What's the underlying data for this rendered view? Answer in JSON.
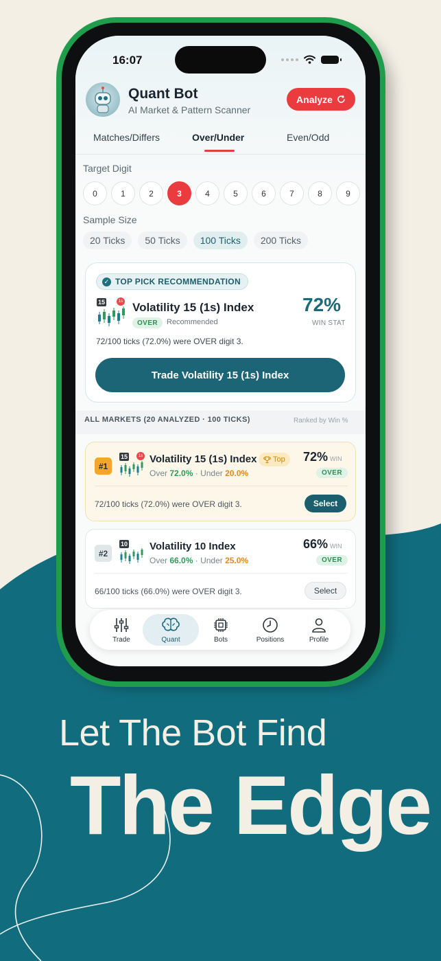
{
  "status": {
    "time": "16:07"
  },
  "app": {
    "title": "Quant Bot",
    "subtitle": "AI Market & Pattern Scanner",
    "analyze_label": "Analyze"
  },
  "tabs": [
    {
      "label": "Matches/Differs",
      "active": false
    },
    {
      "label": "Over/Under",
      "active": true
    },
    {
      "label": "Even/Odd",
      "active": false
    }
  ],
  "target_digit": {
    "label": "Target Digit",
    "options": [
      "0",
      "1",
      "2",
      "3",
      "4",
      "5",
      "6",
      "7",
      "8",
      "9"
    ],
    "selected": "3"
  },
  "sample_size": {
    "label": "Sample Size",
    "options": [
      "20 Ticks",
      "50 Ticks",
      "100 Ticks",
      "200 Ticks"
    ],
    "selected": "100 Ticks"
  },
  "top_pick": {
    "header": "TOP PICK RECOMMENDATION",
    "badge_number": "15",
    "badge_small": "1s",
    "name": "Volatility 15 (1s) Index",
    "direction": "OVER",
    "recommended": "Recommended",
    "percent": "72%",
    "win_stat": "WIN STAT",
    "detail": "72/100 ticks (72.0%) were OVER digit 3.",
    "trade_label": "Trade Volatility 15 (1s) Index"
  },
  "all_markets": {
    "label": "ALL MARKETS (20 ANALYZED · 100 TICKS)",
    "ranked_by": "Ranked by Win %",
    "items": [
      {
        "rank": "#1",
        "badge_number": "15",
        "badge_small": "1s",
        "name": "Volatility 15 (1s) Index",
        "top_tag": "Top",
        "over_label": "Over",
        "over_pct": "72.0%",
        "separator": "·",
        "under_label": "Under",
        "under_pct": "20.0%",
        "percent": "72%",
        "win": "WIN",
        "direction": "OVER",
        "detail": "72/100 ticks (72.0%) were OVER digit 3.",
        "select_label": "Select"
      },
      {
        "rank": "#2",
        "badge_number": "10",
        "name": "Volatility 10 Index",
        "over_label": "Over",
        "over_pct": "66.0%",
        "separator": "·",
        "under_label": "Under",
        "under_pct": "25.0%",
        "percent": "66%",
        "win": "WIN",
        "direction": "OVER",
        "detail": "66/100 ticks (66.0%) were OVER digit 3.",
        "select_label": "Select"
      }
    ]
  },
  "nav": [
    {
      "label": "Trade",
      "icon": "sliders-icon",
      "active": false
    },
    {
      "label": "Quant",
      "icon": "brain-icon",
      "active": true
    },
    {
      "label": "Bots",
      "icon": "chip-icon",
      "active": false
    },
    {
      "label": "Positions",
      "icon": "clock-icon",
      "active": false
    },
    {
      "label": "Profile",
      "icon": "user-icon",
      "active": false
    }
  ],
  "promo": {
    "line1": "Let The Bot Find",
    "line2": "The Edge"
  },
  "colors": {
    "background": "#f3efe5",
    "teal": "#116d7e",
    "phone_frame": "#1f9d4c",
    "accent_red": "#ea3c3f",
    "primary_teal": "#1b6577",
    "over_green": "#2e9a5c",
    "under_orange": "#e48a1b"
  }
}
